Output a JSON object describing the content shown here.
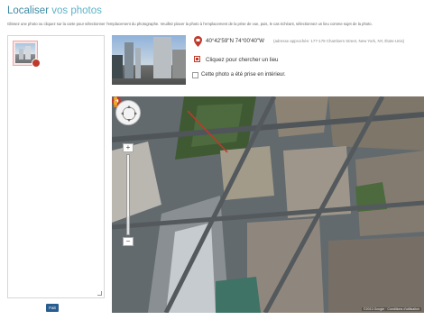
{
  "header": {
    "title_main": "Localiser",
    "title_rest": " vos photos",
    "subtitle": "Glissez une photo ou cliquez sur la carte pour sélectionner l'emplacement du photographe. Veuillez placer la photo à l'emplacement de la prise de vue, puis, le cas échéant, sélectionnez un lieu comme sujet de la photo."
  },
  "photo_list": {
    "done_label": "Fait"
  },
  "location": {
    "coordinates": "40°42'59\"N 74°00'40\"W",
    "approx_address": "(adresse approchée: 177-179 Chambers Street, New York, NY, États-Unis)",
    "search_place_label": "Cliquez pour chercher un lieu",
    "indoor_label": "Cette photo a été prise en intérieur.",
    "indoor_checked": false
  },
  "map": {
    "copyright": "©2013 Google · Conditions d'utilisation",
    "marker_color": "#c0392b"
  },
  "colors": {
    "title": "#3d8ba3",
    "accent": "#5fb3c8",
    "button": "#2a5d8f"
  }
}
